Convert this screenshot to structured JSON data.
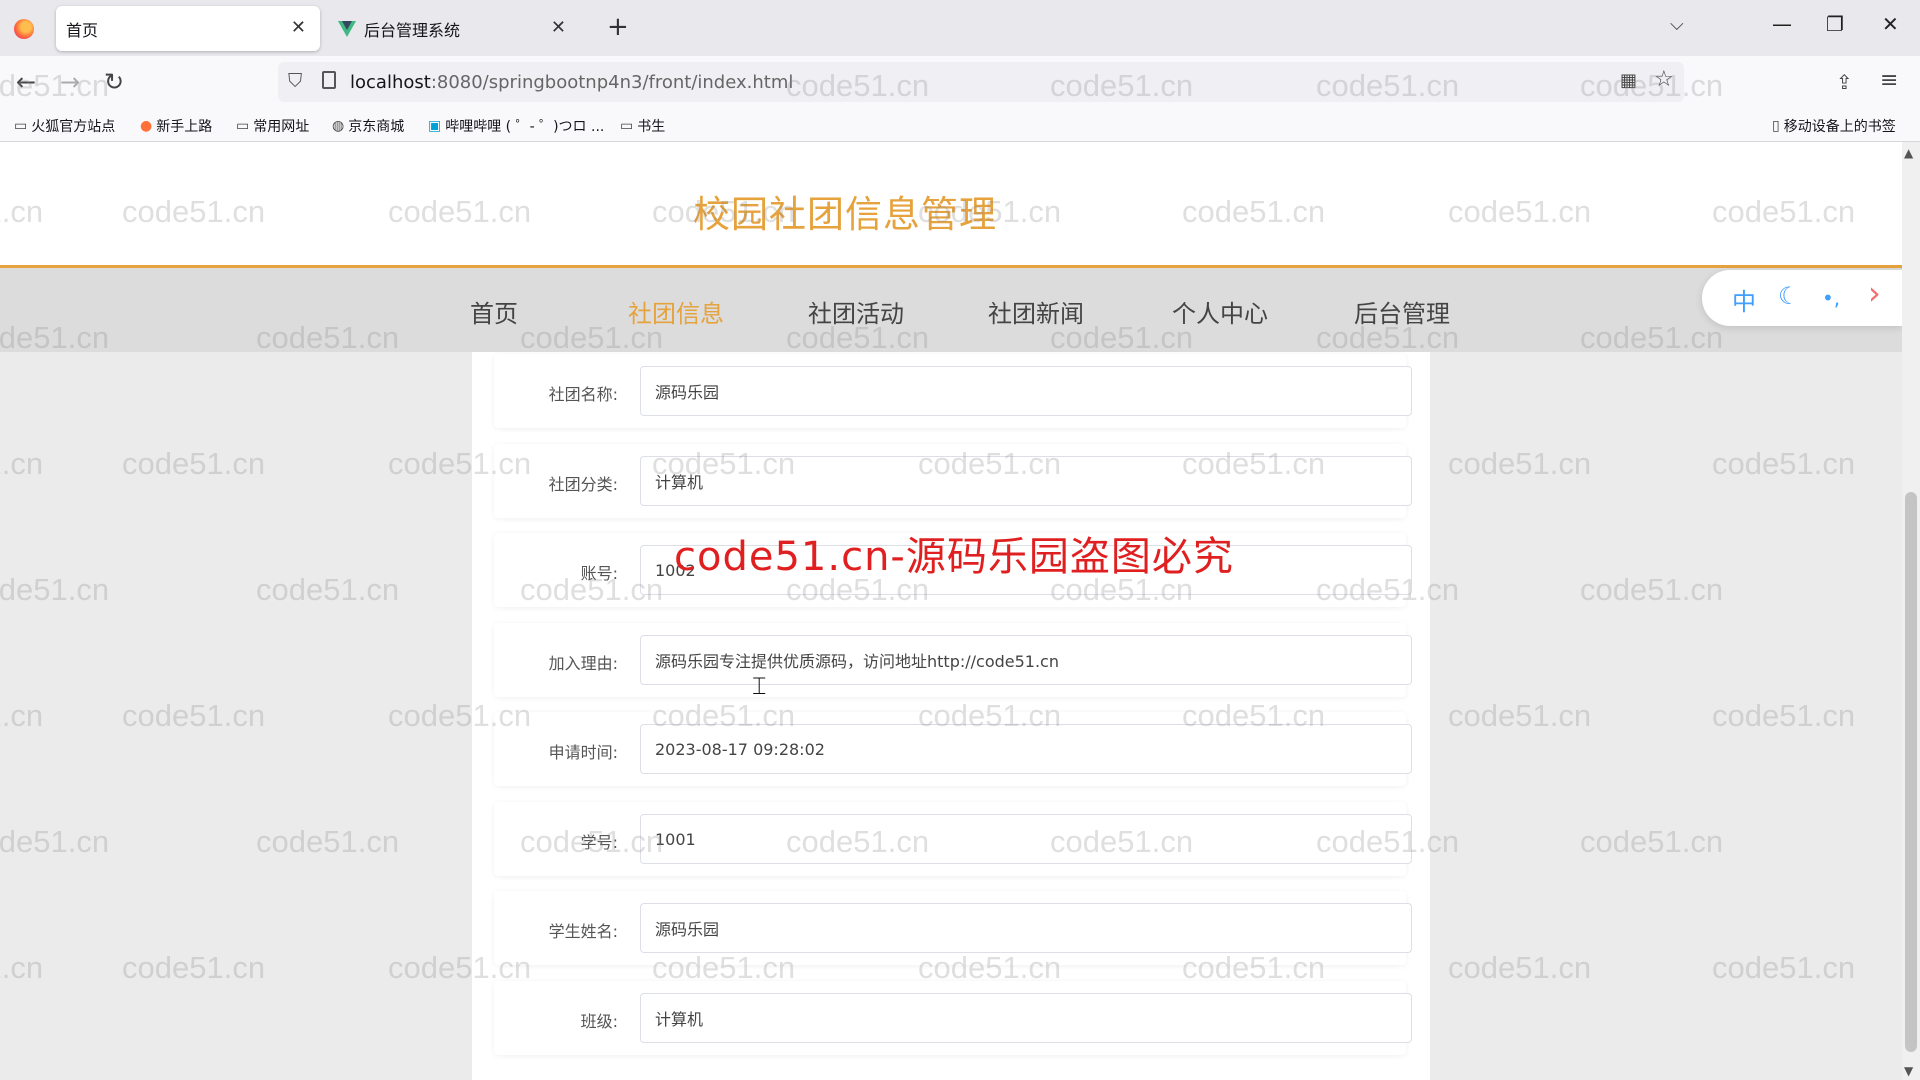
{
  "browser": {
    "tabs": [
      {
        "title": "首页",
        "active": true
      },
      {
        "title": "后台管理系统",
        "active": false
      }
    ],
    "url": {
      "host": "localhost",
      "path": ":8080/springbootnp4n3/front/index.html"
    },
    "bookmarks": [
      "火狐官方站点",
      "新手上路",
      "常用网址",
      "京东商城",
      "哔哩哔哩 ( ゜- ゜)つロ ...",
      "书生"
    ],
    "mobile_bookmarks": "移动设备上的书签"
  },
  "site": {
    "title": "校园社团信息管理",
    "menu": [
      "首页",
      "社团信息",
      "社团活动",
      "社团新闻",
      "个人中心",
      "后台管理"
    ],
    "active_menu": "社团信息",
    "tools": [
      "中",
      "☾",
      "•,",
      "›"
    ]
  },
  "form": {
    "fields": [
      {
        "label": "社团名称:",
        "value": "源码乐园"
      },
      {
        "label": "社团分类:",
        "value": "计算机"
      },
      {
        "label": "账号:",
        "value": "1002"
      },
      {
        "label": "加入理由:",
        "value": "源码乐园专注提供优质源码，访问地址http://code51.cn"
      },
      {
        "label": "申请时间:",
        "value": "2023-08-17 09:28:02"
      },
      {
        "label": "学号:",
        "value": "1001"
      },
      {
        "label": "学生姓名:",
        "value": "源码乐园"
      },
      {
        "label": "班级:",
        "value": "计算机"
      }
    ]
  },
  "watermark": {
    "text": "code51.cn",
    "main": "code51.cn-源码乐园盗图必究"
  }
}
